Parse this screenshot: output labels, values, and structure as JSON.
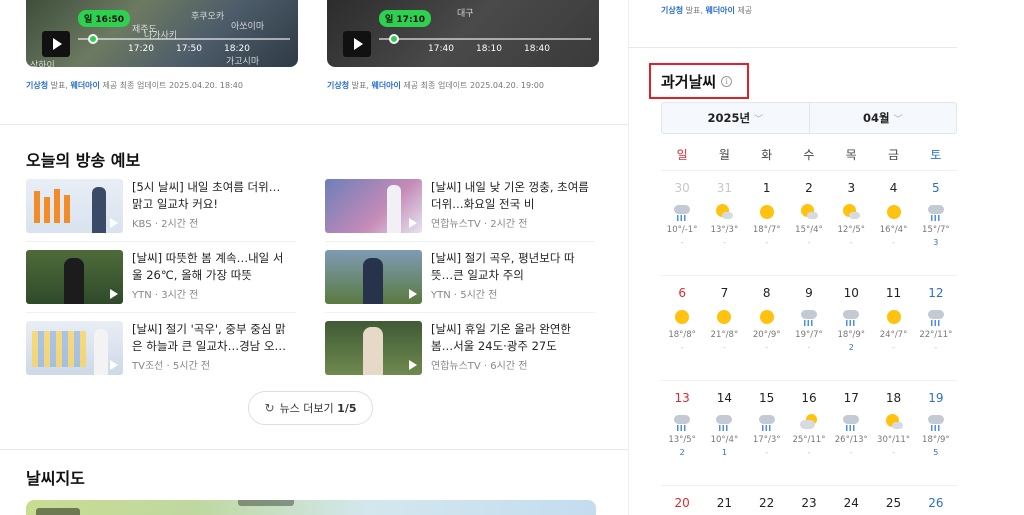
{
  "satellite_card": {
    "time_pill": "일 16:50",
    "ticks": [
      "17:20",
      "17:50",
      "18:20"
    ],
    "places": [
      "후쿠오카",
      "아쏘이마",
      "나가사키",
      "제주도",
      "가고시마",
      "상하이"
    ],
    "credit_source": "기상청",
    "credit_text": " 발표, ",
    "credit_provider": "웨더아이",
    "credit_rest": " 제공 최종 업데이트 2025.04.20. 18:40"
  },
  "radar_card": {
    "time_pill": "일 17:10",
    "ticks": [
      "17:40",
      "18:10",
      "18:40"
    ],
    "places": [
      "대구"
    ],
    "credit_source": "기상청",
    "credit_text": " 발표, ",
    "credit_provider": "웨더아이",
    "credit_rest": " 제공 최종 업데이트 2025.04.20. 19:00"
  },
  "broadcast": {
    "title": "오늘의 방송 예보",
    "items": [
      {
        "title": "[5시 날씨] 내일 초여름 더위… 맑고 일교차 커요!",
        "meta": "KBS · 2시간 전"
      },
      {
        "title": "[날씨] 내일 낮 기온 껑충, 초여름 더위…화요일 전국 비",
        "meta": "연합뉴스TV · 2시간 전"
      },
      {
        "title": "[날씨] 따뜻한 봄 계속…내일 서울 26℃, 올해 가장 따뜻",
        "meta": "YTN · 3시간 전"
      },
      {
        "title": "[날씨] 절기 곡우, 평년보다 따뜻…큰 일교차 주의",
        "meta": "YTN · 5시간 전"
      },
      {
        "title": "[날씨] 절기 '곡우', 중부 중심 맑은 하늘과 큰 일교차…경남 오…",
        "meta": "TV조선 · 5시간 전"
      },
      {
        "title": "[날씨] 휴일 기온 올라 완연한 봄…서울 24도·광주 27도",
        "meta": "연합뉴스TV · 6시간 전"
      }
    ],
    "more_label": "뉴스 더보기",
    "more_page": "1/5"
  },
  "weather_map": {
    "title": "날씨지도"
  },
  "right_credit": {
    "source": "기상청",
    "text": " 발표, ",
    "provider": "웨더아이",
    "rest": " 제공"
  },
  "past_weather": {
    "title": "과거날씨",
    "info_icon": "i",
    "year": "2025년",
    "month": "04월",
    "weekdays": [
      "일",
      "월",
      "화",
      "수",
      "목",
      "금",
      "토"
    ],
    "weeks": [
      [
        {
          "day": "30",
          "icon": "rain",
          "temp": "10°/-1°",
          "rain": "-",
          "dim": true
        },
        {
          "day": "31",
          "icon": "partly",
          "temp": "13°/3°",
          "rain": "-",
          "dim": true
        },
        {
          "day": "1",
          "icon": "sunny",
          "temp": "18°/7°",
          "rain": "-"
        },
        {
          "day": "2",
          "icon": "partly",
          "temp": "15°/4°",
          "rain": "-"
        },
        {
          "day": "3",
          "icon": "partly",
          "temp": "12°/5°",
          "rain": "-"
        },
        {
          "day": "4",
          "icon": "sunny",
          "temp": "16°/4°",
          "rain": "-"
        },
        {
          "day": "5",
          "icon": "rain",
          "temp": "15°/7°",
          "rain": "3"
        }
      ],
      [
        {
          "day": "6",
          "icon": "sunny",
          "temp": "18°/8°",
          "rain": "-"
        },
        {
          "day": "7",
          "icon": "sunny",
          "temp": "21°/8°",
          "rain": "-"
        },
        {
          "day": "8",
          "icon": "sunny",
          "temp": "20°/9°",
          "rain": "-"
        },
        {
          "day": "9",
          "icon": "rain",
          "temp": "19°/7°",
          "rain": "-"
        },
        {
          "day": "10",
          "icon": "rain",
          "temp": "18°/9°",
          "rain": "2"
        },
        {
          "day": "11",
          "icon": "sunny",
          "temp": "24°/7°",
          "rain": "-"
        },
        {
          "day": "12",
          "icon": "rain",
          "temp": "22°/11°",
          "rain": "-"
        }
      ],
      [
        {
          "day": "13",
          "icon": "rain",
          "temp": "13°/5°",
          "rain": "2"
        },
        {
          "day": "14",
          "icon": "rain",
          "temp": "10°/4°",
          "rain": "1"
        },
        {
          "day": "15",
          "icon": "rain",
          "temp": "17°/3°",
          "rain": "-"
        },
        {
          "day": "16",
          "icon": "cloudsun",
          "temp": "25°/11°",
          "rain": "-"
        },
        {
          "day": "17",
          "icon": "rain",
          "temp": "26°/13°",
          "rain": "-"
        },
        {
          "day": "18",
          "icon": "partly",
          "temp": "30°/11°",
          "rain": "-"
        },
        {
          "day": "19",
          "icon": "rain",
          "temp": "18°/9°",
          "rain": "5"
        }
      ]
    ],
    "last_week_days": [
      "20",
      "21",
      "22",
      "23",
      "24",
      "25",
      "26"
    ]
  }
}
